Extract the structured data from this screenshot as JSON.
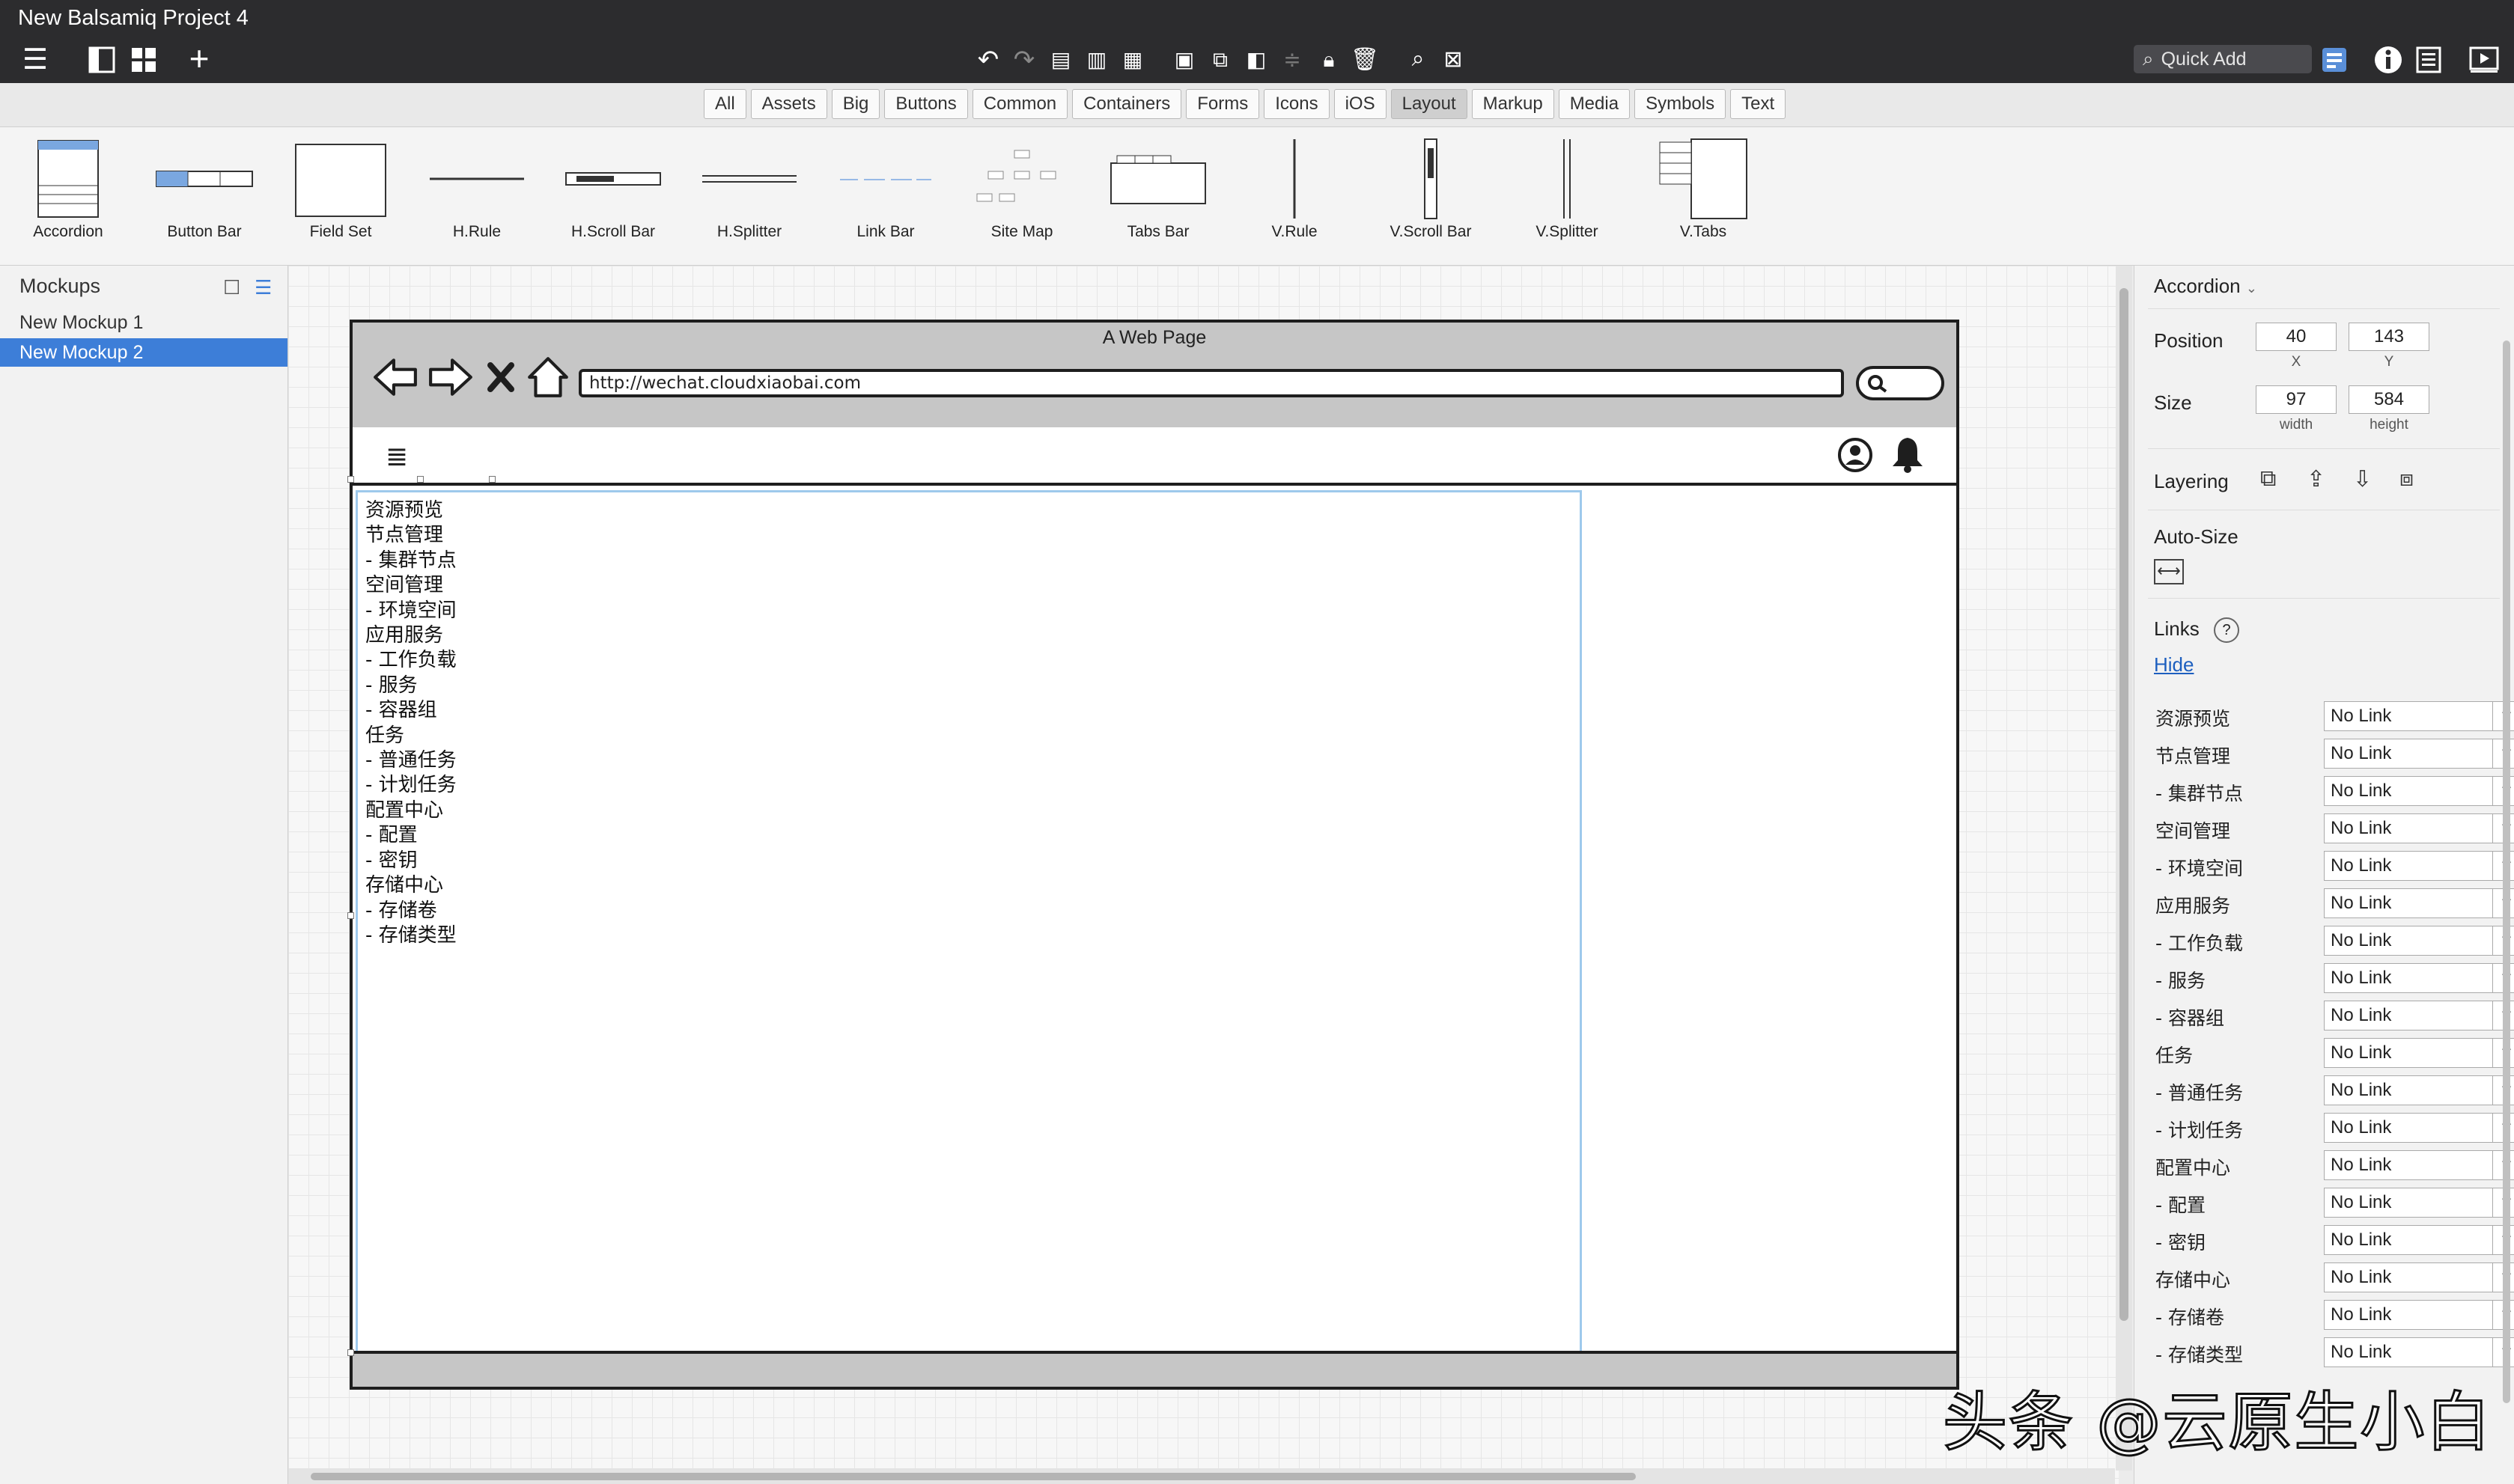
{
  "window": {
    "title": "New Balsamiq Project 4"
  },
  "toolbar": {
    "quick_add_placeholder": "Quick Add"
  },
  "filter_tabs": [
    "All",
    "Assets",
    "Big",
    "Buttons",
    "Common",
    "Containers",
    "Forms",
    "Icons",
    "iOS",
    "Layout",
    "Markup",
    "Media",
    "Symbols",
    "Text"
  ],
  "filter_active": "Layout",
  "library": {
    "items": [
      "Accordion",
      "Button Bar",
      "Field Set",
      "H.Rule",
      "H.Scroll Bar",
      "H.Splitter",
      "Link Bar",
      "Site Map",
      "Tabs Bar",
      "V.Rule",
      "V.Scroll Bar",
      "V.Splitter",
      "V.Tabs"
    ]
  },
  "mockups": {
    "title": "Mockups",
    "items": [
      "New Mockup 1",
      "New Mockup 2"
    ],
    "selected": "New Mockup 2"
  },
  "browser": {
    "title": "A Web Page",
    "url": "http://wechat.cloudxiaobai.com"
  },
  "accordion": {
    "items": [
      "资源预览",
      "节点管理",
      "- 集群节点",
      "空间管理",
      "- 环境空间",
      "应用服务",
      "- 工作负载",
      "- 服务",
      "- 容器组",
      "任务",
      "- 普通任务",
      "- 计划任务",
      "配置中心",
      "- 配置",
      "- 密钥",
      "存储中心",
      "- 存储卷",
      "- 存储类型"
    ]
  },
  "properties": {
    "component": "Accordion",
    "position_label": "Position",
    "x": "40",
    "x_label": "X",
    "y": "143",
    "y_label": "Y",
    "size_label": "Size",
    "width": "97",
    "width_label": "width",
    "height": "584",
    "height_label": "height",
    "layering_label": "Layering",
    "autosize_label": "Auto-Size",
    "links_label": "Links",
    "links_help": "?",
    "hide_label": "Hide",
    "link_rows": [
      {
        "name": "资源预览",
        "value": "No Link"
      },
      {
        "name": "节点管理",
        "value": "No Link"
      },
      {
        "name": "- 集群节点",
        "value": "No Link"
      },
      {
        "name": "空间管理",
        "value": "No Link"
      },
      {
        "name": "- 环境空间",
        "value": "No Link"
      },
      {
        "name": "应用服务",
        "value": "No Link"
      },
      {
        "name": "- 工作负载",
        "value": "No Link"
      },
      {
        "name": "- 服务",
        "value": "No Link"
      },
      {
        "name": "- 容器组",
        "value": "No Link"
      },
      {
        "name": "任务",
        "value": "No Link"
      },
      {
        "name": "- 普通任务",
        "value": "No Link"
      },
      {
        "name": "- 计划任务",
        "value": "No Link"
      },
      {
        "name": "配置中心",
        "value": "No Link"
      },
      {
        "name": "- 配置",
        "value": "No Link"
      },
      {
        "name": "- 密钥",
        "value": "No Link"
      },
      {
        "name": "存储中心",
        "value": "No Link"
      },
      {
        "name": "- 存储卷",
        "value": "No Link"
      },
      {
        "name": "- 存储类型",
        "value": "No Link"
      }
    ]
  },
  "watermark": "头条 @云原生小白",
  "colors": {
    "accent": "#3d7ed8",
    "toolbar_bg": "#2c2c2e",
    "selection": "#9ec9ec"
  }
}
